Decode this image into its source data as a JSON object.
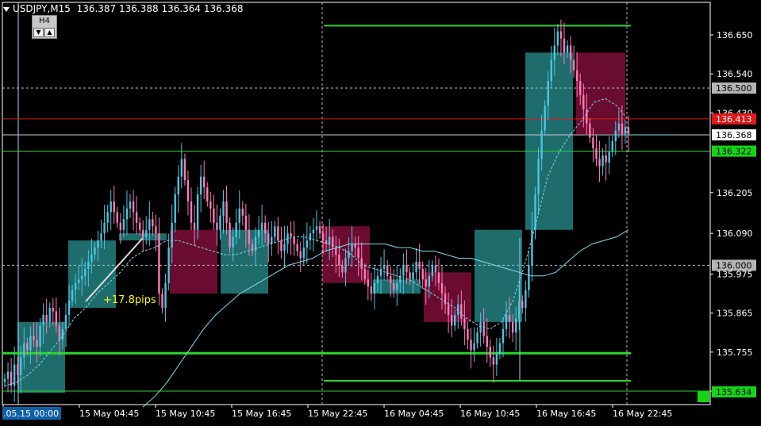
{
  "header": {
    "symbol_timeframe": "USDJPY,M15",
    "ohlc": "136.387 136.388 136.364 136.368"
  },
  "timeframe_widget": {
    "label": "H4",
    "down_symbol": "▼",
    "up_symbol": "▲"
  },
  "colors": {
    "background": "#000000",
    "bull": "#4cc6e0",
    "bear": "#ff7ab8",
    "h4_bull_box": "#1f6c6c",
    "h4_bear_box": "#6a0c30",
    "ma": "#7fdcf0",
    "level_green": "#2bd62b",
    "level_red": "#e01818",
    "grid": "#bbbbbb"
  },
  "chart_data": {
    "type": "candlestick",
    "symbol": "USDJPY",
    "timeframe": "M15",
    "ylim": [
      135.6,
      136.7
    ],
    "yticks": [
      "136.650",
      "136.540",
      "136.430",
      "136.205",
      "136.090",
      "135.975",
      "135.865",
      "135.755",
      "135.645"
    ],
    "xticks": [
      ".05.15 00:00",
      "15 May 04:45",
      "15 May 10:45",
      "15 May 16:45",
      "15 May 22:45",
      "16 May 04:45",
      "16 May 10:45",
      "16 May 16:45",
      "16 May 22:45"
    ],
    "price_labels": [
      {
        "value": "136.500",
        "style": "grey"
      },
      {
        "value": "136.413",
        "style": "red"
      },
      {
        "value": "136.368",
        "style": "white"
      },
      {
        "value": "136.322",
        "style": "green"
      },
      {
        "value": "136.000",
        "style": "grey"
      },
      {
        "value": "135.634",
        "style": "green"
      }
    ],
    "annotation": "+17.8pips",
    "h4_boxes": [
      {
        "open": 135.84,
        "close": 135.64,
        "type": "bull"
      },
      {
        "open": 135.88,
        "close": 136.07,
        "type": "bull"
      },
      {
        "open": 136.09,
        "close": 136.07,
        "type": "bull"
      },
      {
        "open": 136.1,
        "close": 135.92,
        "type": "bear"
      },
      {
        "open": 135.92,
        "close": 136.1,
        "type": "bull"
      },
      {
        "open": 136.11,
        "close": 135.95,
        "type": "bear"
      },
      {
        "open": 135.96,
        "close": 135.92,
        "type": "bull"
      },
      {
        "open": 135.98,
        "close": 135.84,
        "type": "bear"
      },
      {
        "open": 135.84,
        "close": 136.1,
        "type": "bull"
      },
      {
        "open": 136.1,
        "close": 136.6,
        "type": "bull"
      },
      {
        "open": 136.6,
        "close": 136.37,
        "type": "bear"
      }
    ],
    "levels": {
      "green_thin": [
        136.676,
        136.322,
        135.632,
        135.625
      ],
      "green_thick": 135.752,
      "red": 136.413,
      "grey_dashed": [
        136.5,
        136.0
      ]
    },
    "ma_fast": [
      135.66,
      135.67,
      135.69,
      135.72,
      135.76,
      135.8,
      135.85,
      135.88,
      135.92,
      135.95,
      135.98,
      136.02,
      136.04,
      136.05,
      136.07,
      136.07,
      136.06,
      136.05,
      136.04,
      136.03,
      136.03,
      136.04,
      136.05,
      136.06,
      136.07,
      136.08,
      136.08,
      136.07,
      136.06,
      136.05,
      136.03,
      136.0,
      135.99,
      135.98,
      135.97,
      135.96,
      135.94,
      135.92,
      135.9,
      135.88,
      135.85,
      135.83,
      135.82,
      135.84,
      135.9,
      136.0,
      136.12,
      136.25,
      136.32,
      136.37,
      136.41,
      136.46,
      136.47,
      136.45,
      136.41
    ],
    "ma_slow": [
      135.6,
      135.63,
      135.67,
      135.72,
      135.77,
      135.82,
      135.86,
      135.89,
      135.92,
      135.94,
      135.96,
      135.98,
      136.0,
      136.01,
      136.02,
      136.04,
      136.05,
      136.06,
      136.06,
      136.06,
      136.06,
      136.05,
      136.05,
      136.04,
      136.04,
      136.03,
      136.02,
      136.02,
      136.01,
      136.0,
      135.99,
      135.98,
      135.97,
      135.97,
      135.98,
      136.01,
      136.04,
      136.06,
      136.07,
      136.08,
      136.1
    ],
    "candles_closes": [
      135.68,
      135.7,
      135.66,
      135.72,
      135.69,
      135.74,
      135.78,
      135.76,
      135.8,
      135.79,
      135.77,
      135.83,
      135.86,
      135.84,
      135.88,
      135.87,
      135.83,
      135.79,
      135.82,
      135.86,
      135.9,
      135.93,
      135.95,
      135.96,
      135.97,
      135.99,
      136.01,
      136.03,
      136.05,
      136.07,
      136.09,
      136.12,
      136.15,
      136.18,
      136.15,
      136.12,
      136.1,
      136.13,
      136.16,
      136.18,
      136.15,
      136.12,
      136.1,
      136.08,
      136.1,
      136.13,
      136.11,
      136.09,
      135.92,
      135.88,
      135.95,
      136.05,
      136.12,
      136.2,
      136.25,
      136.3,
      136.24,
      136.18,
      136.12,
      136.1,
      136.2,
      136.25,
      136.22,
      136.18,
      136.16,
      136.12,
      136.1,
      136.14,
      136.18,
      136.12,
      136.05,
      136.08,
      136.12,
      136.16,
      136.14,
      136.1,
      136.06,
      136.04,
      136.08,
      136.1,
      136.12,
      136.09,
      136.06,
      136.08,
      136.11,
      136.07,
      136.04,
      136.06,
      136.09,
      136.08,
      136.06,
      136.04,
      136.02,
      136.05,
      136.07,
      136.09,
      136.1,
      136.11,
      136.09,
      136.07,
      136.06,
      136.08,
      136.05,
      136.03,
      136.0,
      135.98,
      136.02,
      136.04,
      136.06,
      136.05,
      136.02,
      135.99,
      135.96,
      135.94,
      135.92,
      135.95,
      135.97,
      135.99,
      136.0,
      135.97,
      135.95,
      135.93,
      135.95,
      135.97,
      136.0,
      135.98,
      135.96,
      135.98,
      136.01,
      135.99,
      135.96,
      135.94,
      135.97,
      136.0,
      135.98,
      135.95,
      135.92,
      135.89,
      135.86,
      135.83,
      135.86,
      135.89,
      135.85,
      135.82,
      135.79,
      135.76,
      135.78,
      135.81,
      135.84,
      135.8,
      135.77,
      135.74,
      135.72,
      135.75,
      135.78,
      135.82,
      135.86,
      135.84,
      135.81,
      135.85,
      135.9,
      135.88,
      135.93,
      136.0,
      136.1,
      136.2,
      136.3,
      136.38,
      136.45,
      136.52,
      136.58,
      136.62,
      136.66,
      136.64,
      136.6,
      136.62,
      136.58,
      136.55,
      136.52,
      136.48,
      136.44,
      136.4,
      136.36,
      136.33,
      136.3,
      136.28,
      136.31,
      136.29,
      136.32,
      136.35,
      136.38,
      136.4,
      136.37,
      136.39,
      136.37
    ]
  }
}
